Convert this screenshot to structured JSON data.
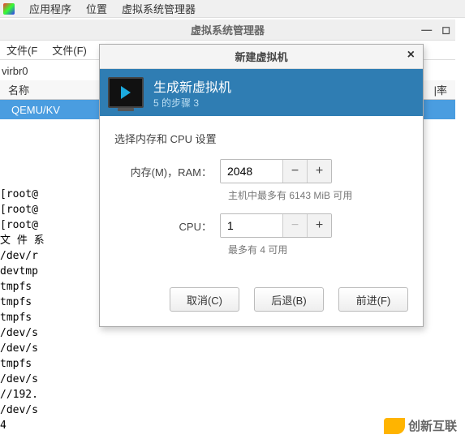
{
  "menubar": {
    "apps": "应用程序",
    "location": "位置",
    "vmm": "虚拟系统管理器"
  },
  "vmm": {
    "title": "虚拟系统管理器",
    "file_menu_1": "文件(F",
    "file_menu_2": "文件(F)",
    "virbr": "virbr0",
    "col_name": "名称",
    "col_usage": "|率",
    "row1": "QEMU/KV"
  },
  "dialog": {
    "title": "新建虚拟机",
    "close": "×",
    "banner_title": "生成新虚拟机",
    "banner_step": "5 的步骤 3",
    "section": "选择内存和  CPU 设置",
    "ram_label": "内存(M)，RAM：",
    "ram_value": "2048",
    "ram_hint": "主机中最多有  6143  MiB 可用",
    "cpu_label": "CPU：",
    "cpu_value": "1",
    "cpu_hint": "最多有  4  可用",
    "cancel": "取消(C)",
    "back": "后退(B)",
    "forward": "前进(F)"
  },
  "terminal": "[root@\n[root@\n[root@\n文 件 系\n/dev/r\ndevtmp\ntmpfs\ntmpfs\ntmpfs\n/dev/s\n/dev/s\ntmpfs\n/dev/s\n//192.\n/dev/s\n4",
  "brand": {
    "text": "创新互联"
  }
}
